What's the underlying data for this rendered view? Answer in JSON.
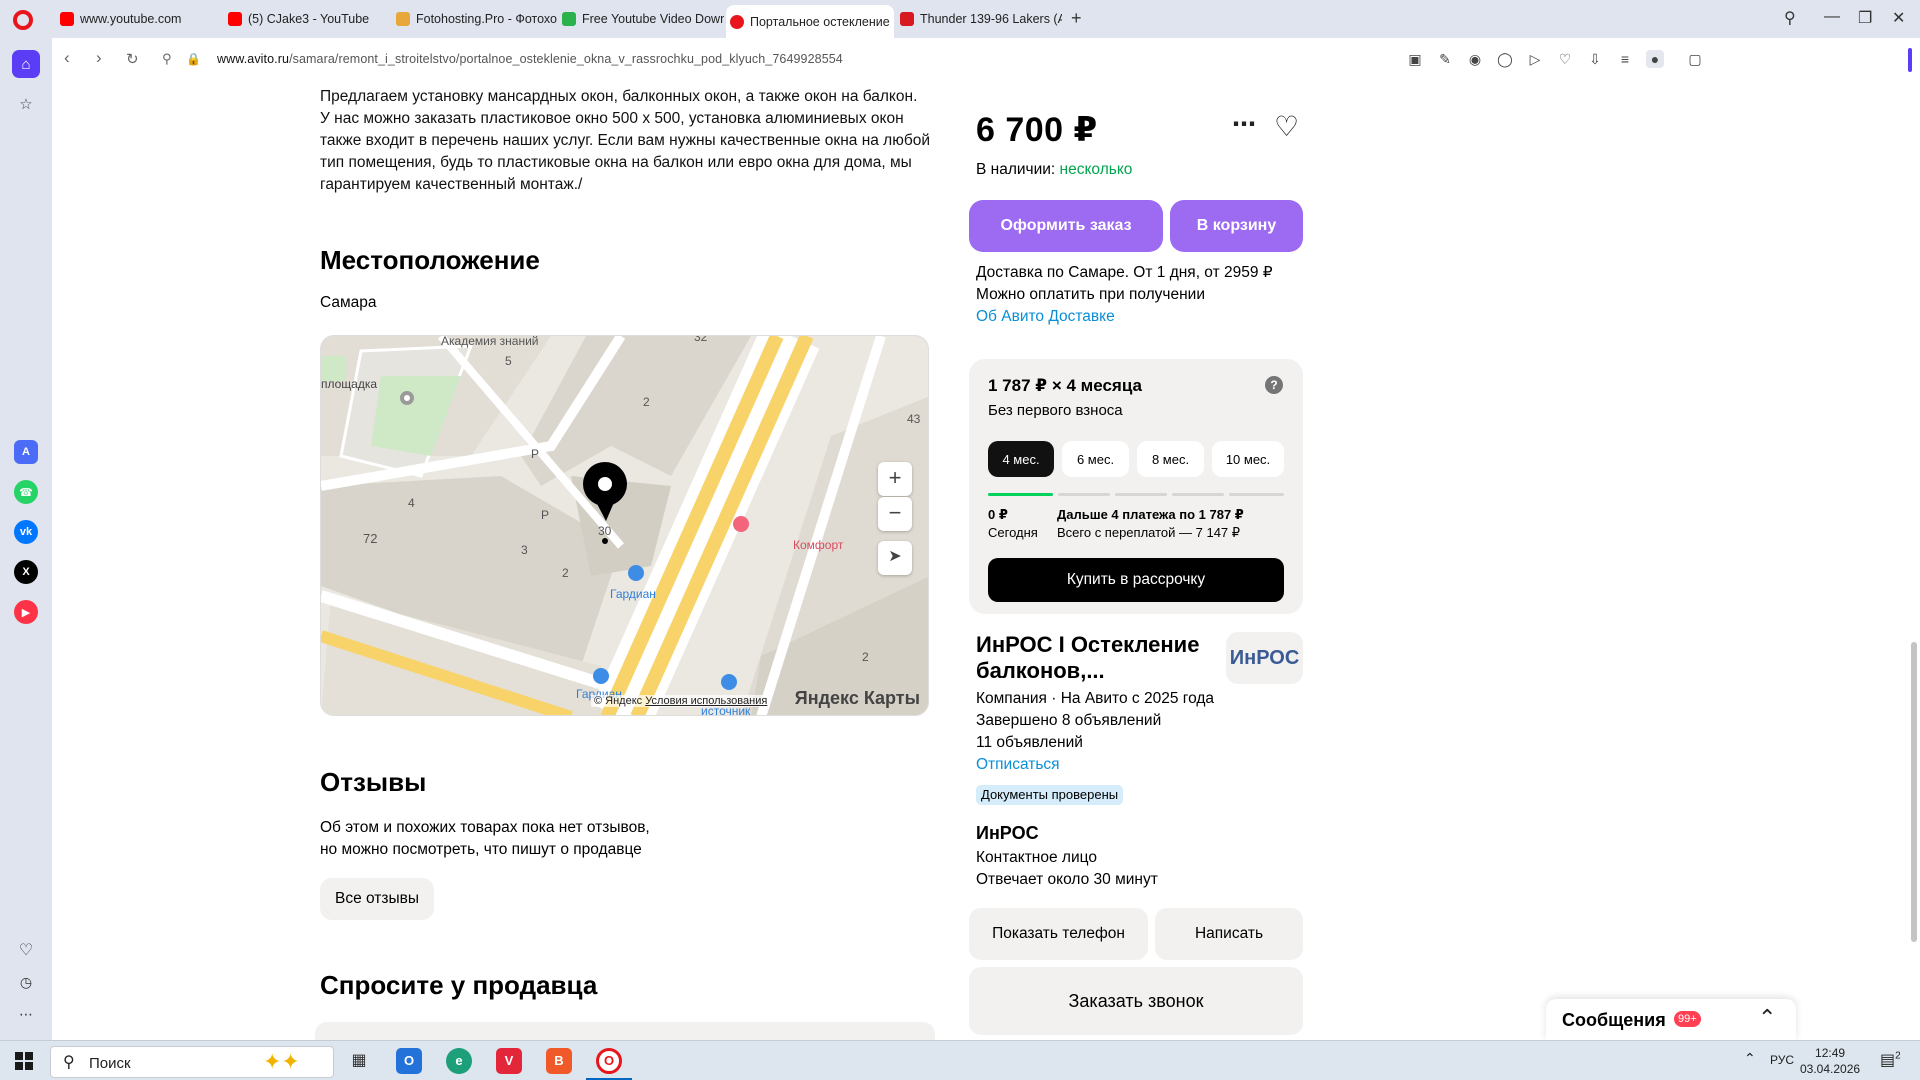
{
  "browser": {
    "tabs": [
      {
        "title": "www.youtube.com",
        "favicon_color": "#ff0000"
      },
      {
        "title": "(5) CJake3 - YouTube",
        "favicon_color": "#ff0000"
      },
      {
        "title": "Fotohosting.Pro - Фотохо",
        "favicon_color": "#e8a73a"
      },
      {
        "title": "Free Youtube Video Down",
        "favicon_color": "#2bb24c"
      },
      {
        "title": "Портальное остекление",
        "favicon_color": "#e8151d"
      },
      {
        "title": "Thunder 139-96 Lakers (A",
        "favicon_color": "#d71920"
      }
    ],
    "url_domain": "www.avito.ru",
    "url_path": "/samara/remont_i_stroitelstvo/portalnoe_osteklenie_okna_v_rassrochku_pod_klyuch_7649928554"
  },
  "listing": {
    "description": "Предлагаем установку мансардных окон, балконных окон, а также окон на балкон. У нас можно заказать пластиковое окно 500 x 500, установка алюминиевых окон также входит в перечень наших услуг. Если вам нужны качественные окна на любой тип помещения, будь то пластиковые окна на балкон или евро окна для дома, мы гарантируем качественный монтаж./",
    "location_title": "Местоположение",
    "city": "Самара",
    "reviews_title": "Отзывы",
    "reviews_line1": "Об этом и похожих товарах пока нет отзывов,",
    "reviews_line2": "но можно посмотреть, что пишут о продавце",
    "all_reviews": "Все отзывы",
    "ask_title": "Спросите у продавца"
  },
  "map": {
    "labels": {
      "academy": "Академия знаний",
      "playground": "площадка",
      "comfort": "Комфорт",
      "gardian": "Гардиан",
      "gardian2": "Гардиан",
      "source": "источник",
      "n5": "5",
      "n32": "32",
      "n2a": "2",
      "n43": "43",
      "p1": "P",
      "p2": "P",
      "n4": "4",
      "n72": "72",
      "n3": "3",
      "n2b": "2",
      "n30": "30",
      "n2c": "2"
    },
    "copyright": "© Яндекс",
    "terms": "Условия использования",
    "logo": "Яндекс Карты"
  },
  "purchase": {
    "price": "6 700 ₽",
    "stock_label": "В наличии:",
    "stock_value": "несколько",
    "order_button": "Оформить заказ",
    "cart_button": "В корзину",
    "delivery_line1": "Доставка по Самаре. От 1 дня, от 2959 ₽",
    "delivery_line2": "Можно оплатить при получении",
    "delivery_link": "Об Авито Доставке"
  },
  "installment": {
    "title": "1 787 ₽ × 4 месяца",
    "subtitle": "Без первого взноса",
    "options": [
      "4 мес.",
      "6 мес.",
      "8 мес.",
      "10 мес."
    ],
    "today_amount": "0 ₽",
    "today_label": "Сегодня",
    "next_label": "Дальше 4 платежа по 1 787 ₽",
    "total_label": "Всего с переплатой — 7 147 ₽",
    "buy_button": "Купить в рассрочку"
  },
  "seller": {
    "name": "ИнРОС I Остекление балконов,...",
    "logo_text": "ИнРОС",
    "type_line": "Компания · На Авито с 2025 года",
    "completed": "Завершено 8 объявлений",
    "ads_count": "11 объявлений",
    "unsubscribe": "Отписаться",
    "badge": "Документы проверены",
    "contact_name": "ИнРОС",
    "contact_role": "Контактное лицо",
    "response_time": "Отвечает около 30 минут",
    "show_phone": "Показать телефон",
    "write": "Написать",
    "call_back": "Заказать звонок"
  },
  "messages": {
    "label": "Сообщения",
    "badge": "99+"
  },
  "taskbar": {
    "search_placeholder": "Поиск",
    "lang": "РУС",
    "time": "12:49",
    "date": "03.04.2026",
    "notif_count": "2"
  }
}
